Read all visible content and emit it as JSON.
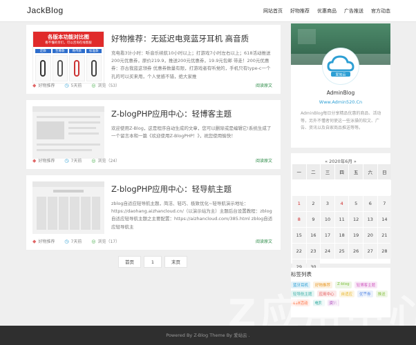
{
  "header": {
    "logo": "JackBlog",
    "nav": [
      "网站首页",
      "好物推荐",
      "优惠商品",
      "广告推送",
      "官方动态"
    ]
  },
  "posts": [
    {
      "title": "好物推荐：无延迟电竞蓝牙耳机 高音质",
      "excerpt": "充电看3计小时：听音乐续航10小时以上；打游戏7小时左右以上；618活动推送200元优惠券，原价219.9，推送200元优惠券，19.9元包邮 带走！200元优惠券：亦古我蓝这领券 优惠券数量有限，打游戏者有听党的，手机只有type-c一个孔的可以买来用，个人觉感不错，绝大家推",
      "category": "好物推荐",
      "time": "5天前",
      "views": "浏览（53）",
      "more": "阅读原文",
      "thumb_title": "各版本功能对比图",
      "thumb_sub": "看不懂的亲们，可以咨询在线客服",
      "thumb_tabs": [
        "定款",
        "至尊款",
        "骨传款",
        "标准款"
      ]
    },
    {
      "title": "Z-blogPHP应用中心：轻博客主题",
      "excerpt": "欢迎使用Z-Blog，这是程序自动生成的文章，您可以删除或是编辑它!系统生成了一个留言本和一篇《欢迎使用Z-BlogPHP！》，祝您使用愉快！",
      "category": "好物推荐",
      "time": "7天前",
      "views": "浏览（24）",
      "more": "阅读原文"
    },
    {
      "title": "Z-blogPHP应用中心：轻导航主题",
      "excerpt": "zblog自适应轻导航主题，简洁、轻巧、极致优化~轻导航演示地址：https://daohang.aizhancloud.cn/（以演示站为主）主题后台设置教程：zblog自适应轻导航主题之主要配置：https://aizhancloud.com/385.html zblog自适应轻导航主",
      "category": "好物推荐",
      "time": "7天前",
      "views": "浏览（17）",
      "more": "阅读原文"
    }
  ],
  "pager": [
    "首页",
    "1",
    "末页"
  ],
  "profile": {
    "logo_text": "爱站云",
    "name": "AdminBlog",
    "site": "Www.Admin520.Cn",
    "desc": "AdminBlog每日分享精品优惠的商品、活动等，另外不懂者何使这一些泳操的软文、广告、资讯以及自家商品推送等等。"
  },
  "calendar": {
    "header": "« 2020年6月 »",
    "weekdays": [
      "一",
      "二",
      "三",
      "四",
      "五",
      "六",
      "日"
    ],
    "days": [
      "",
      "",
      "",
      "",
      "",
      "",
      "",
      "1",
      "2",
      "3",
      "4",
      "5",
      "6",
      "7",
      "8",
      "9",
      "10",
      "11",
      "12",
      "13",
      "14",
      "15",
      "16",
      "17",
      "18",
      "19",
      "20",
      "21",
      "22",
      "23",
      "24",
      "25",
      "26",
      "27",
      "28",
      "29",
      "30"
    ],
    "highlighted": [
      "1",
      "4",
      "8"
    ]
  },
  "tags": {
    "title": "标签列表",
    "items": [
      {
        "label": "蓝牙耳机",
        "color": "#2d9fd4"
      },
      {
        "label": "好物推荐",
        "color": "#e89b2c"
      },
      {
        "label": "Z-blog",
        "color": "#7bbf3a"
      },
      {
        "label": "轻博客主题",
        "color": "#cf5bc0"
      },
      {
        "label": "轻导航主题",
        "color": "#3fb1a8"
      },
      {
        "label": "应用中心",
        "color": "#e45b5b"
      },
      {
        "label": "自适应",
        "color": "#e8b72c"
      },
      {
        "label": "优惠券",
        "color": "#5b8be4"
      },
      {
        "label": "推送",
        "color": "#8bc34a"
      },
      {
        "label": "618活动",
        "color": "#ff7043"
      },
      {
        "label": "电竞",
        "color": "#26a69a"
      },
      {
        "label": "资讯",
        "color": "#ab47bc"
      }
    ]
  },
  "footer": "Powered By Z-Blog Theme By 爱站云 .",
  "watermark": "Z应用中心"
}
